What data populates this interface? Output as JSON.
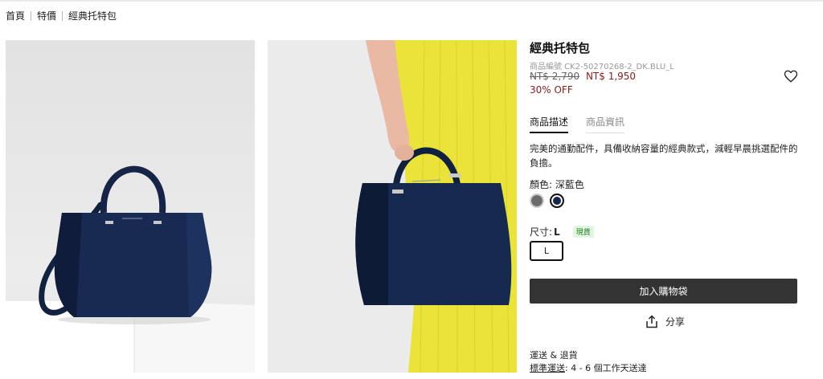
{
  "breadcrumb": {
    "items": [
      "首頁",
      "特價",
      "經典托特包"
    ]
  },
  "images": {
    "photo1": "navy-tote-on-pedestal",
    "photo2": "navy-tote-held-by-model"
  },
  "product": {
    "title": "經典托特包",
    "sku": "商品編號 CK2-50270268-2_DK.BLU_L",
    "original_price": "NT$ 2,790",
    "sale_price": "NT$ 1,950",
    "discount": "30% OFF",
    "wishlist_icon": "heart-outline-icon"
  },
  "tabs": [
    {
      "label": "商品描述",
      "active": true
    },
    {
      "label": "商品資訊",
      "active": false
    }
  ],
  "description": "完美的通勤配件，具備收納容量的經典款式，減輕早晨挑選配件的負擔。",
  "color": {
    "label": "顏色: 深藍色",
    "swatches": [
      {
        "name": "grey",
        "hex": "#6a6a6a",
        "selected": false
      },
      {
        "name": "dark-blue",
        "hex": "#16254a",
        "selected": true
      }
    ]
  },
  "size": {
    "label": "尺寸:",
    "value": "L",
    "stock_badge": "現貨",
    "options": [
      "L"
    ]
  },
  "actions": {
    "add_to_cart": "加入購物袋",
    "share": "分享"
  },
  "shipping": {
    "title": "運送 & 退貨",
    "method_link": "標準運送",
    "method_detail": ": 4 - 6 個工作天送達"
  },
  "colors": {
    "sale_red": "#8b1a1a",
    "button_dark": "#333333",
    "in_stock_bg": "#e3f6e3",
    "in_stock_text": "#1e7a1e",
    "bag_navy": "#16254a"
  }
}
